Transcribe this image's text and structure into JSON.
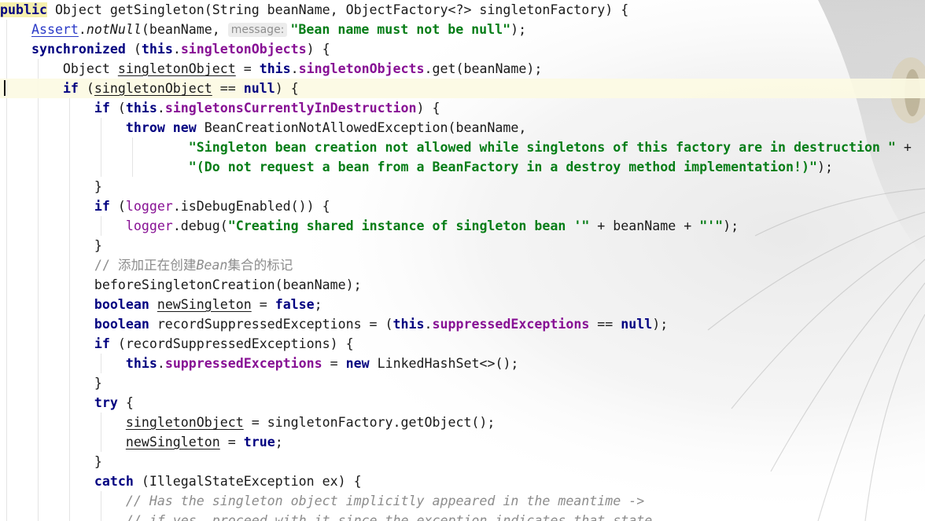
{
  "editor": {
    "hint_label": "message:",
    "comment_add_marker": "// 添加正在创建",
    "comment_bean_word": "Bean",
    "comment_set_marker": "集合的标记",
    "comment_meantime": "// Has the singleton object implicitly appeared in the meantime ->",
    "comment_if_yes": "// if yes, proceed with it since the exception indicates that state.",
    "str_bean_name": "\"Bean name must not be null\"",
    "str_not_allowed": "\"Singleton bean creation not allowed while singletons of this factory are in destruction \"",
    "str_do_not_request": "\"(Do not request a bean from a BeanFactory in a destroy method implementation!)\"",
    "str_creating": "\"Creating shared instance of singleton bean '\"",
    "str_quote": "\"'\""
  }
}
